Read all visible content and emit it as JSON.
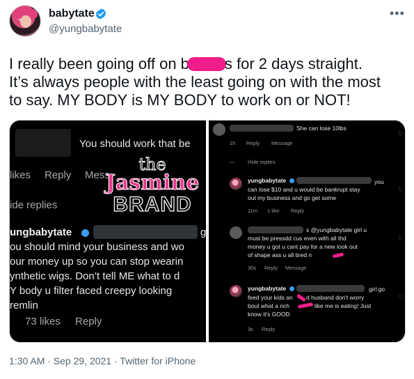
{
  "user": {
    "display_name": "babytate",
    "handle": "@yungbabytate"
  },
  "tweet": {
    "line1_before": "I really been going off on b",
    "line1_after": "s for 2 days straight.",
    "line2": "It’s always people with the least going on with the most",
    "line3": "to say. MY BODY is MY BODY to work on or NOT!"
  },
  "left_panel": {
    "comment_text": "You should work that be",
    "likes": "likes",
    "reply": "Reply",
    "message": "Mess",
    "hide_replies": "ide replies",
    "reply_author": "ungbabytate",
    "reply_trail": "g",
    "reply_lines": [
      "ou should mind your business and wo",
      "our money up so you can stop wearin",
      "ynthetic wigs. Don’t tell ME what to d",
      "Y body u filter faced creepy looking",
      "remlin"
    ],
    "reply_likes": "73 likes",
    "reply_reply": "Reply"
  },
  "watermark": {
    "line1": "the",
    "line2": "Jasmine",
    "line3": "BRAND"
  },
  "right_panel": {
    "c1_text": "She can lose 10lbs",
    "c1_time": "1h",
    "c1_reply": "Reply",
    "c1_message": "Message",
    "hide_replies": "Hide replies",
    "r1_author": "yungbabytate",
    "r1_lines": [
      "you",
      "can lose $10 and u would be bankrupt stay",
      "out my business and go get some"
    ],
    "r1_time": "11m",
    "r1_likes": "1 like",
    "r1_reply": "Reply",
    "r2_head": "s @yungbabytate girl u",
    "r2_lines": [
      "must be pressdd cus even with all thd",
      "money u got u cant pay for a new look out",
      "of shape ass u all tired n"
    ],
    "r2_time": "30s",
    "r2_reply": "Reply",
    "r2_message": "Message",
    "r3_author": "yungbabytate",
    "r3_head_tail": "girl go",
    "r3_lines": [
      "feed your kids an",
      "d husband don't worry",
      "bout what a rich",
      "like me is eating! Just",
      "know it's GOOD"
    ],
    "r3_time": "3s",
    "r3_reply": "Reply"
  },
  "footer": {
    "meta": "1:30 AM · Sep 29, 2021 · Twitter for iPhone"
  },
  "colors": {
    "verified": "#1d9bf0",
    "redaction": "#f01d8a",
    "watermark_pink": "#e73a8e"
  }
}
